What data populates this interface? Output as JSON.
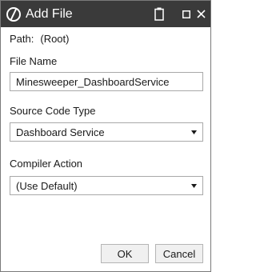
{
  "window": {
    "title": "Add File",
    "icons": {
      "app": "app-logo-icon",
      "clipboard": "clipboard-icon",
      "maximize": "maximize-icon",
      "close": "close-icon"
    },
    "colors": {
      "titlebar": "#3a3a3a",
      "title_text": "#ffffff"
    }
  },
  "path": {
    "label": "Path:",
    "value": "(Root)"
  },
  "file_name": {
    "label": "File Name",
    "value": "Minesweeper_DashboardService"
  },
  "source_code_type": {
    "label": "Source Code Type",
    "selected": "Dashboard Service"
  },
  "compiler_action": {
    "label": "Compiler Action",
    "selected": "(Use Default)"
  },
  "buttons": {
    "ok": "OK",
    "cancel": "Cancel"
  }
}
